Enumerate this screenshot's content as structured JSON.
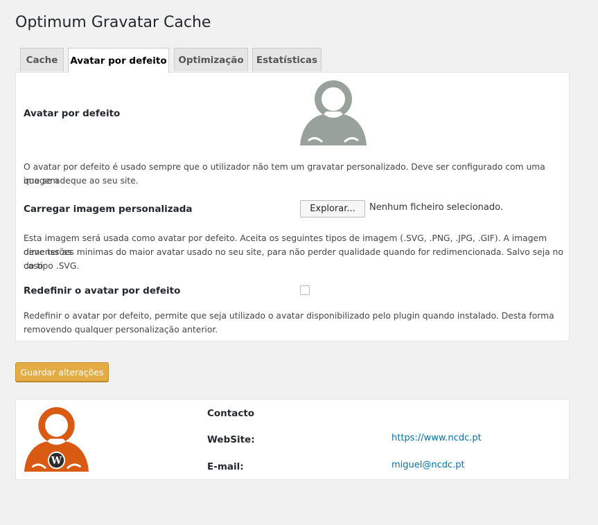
{
  "page_title": "Optimum Gravatar Cache",
  "tabs": [
    {
      "label": "Cache"
    },
    {
      "label": "Avatar por defeito"
    },
    {
      "label": "Optimização"
    },
    {
      "label": "Estatísticas"
    }
  ],
  "active_tab": "Avatar por defeito",
  "settings": {
    "default_avatar_label": "Avatar por defeito",
    "default_avatar_desc_1": "O avatar por defeito é usado sempre que o utilizador não tem um gravatar personalizado. Deve ser configurado com uma imagem",
    "default_avatar_desc_2": "que se adeque ao seu site.",
    "upload_label": "Carregar imagem personalizada",
    "upload_button": "Explorar...",
    "upload_status": "Nenhum ficheiro selecionado.",
    "upload_desc_1": "Esta imagem será usada como avatar por defeito. Aceita os seguintes tipos de imagem (.SVG, .PNG, .JPG, .GIF). A imagem deve ter as",
    "upload_desc_2": "dimenssões minimas do maior avatar usado no seu site, para não perder qualidade quando for redimencionada. Salvo seja no caso",
    "upload_desc_3": "do tipo .SVG.",
    "reset_label": "Redefinir o avatar por defeito",
    "reset_checked": false,
    "reset_desc_1": "Redefinir o avatar por defeito, permite que seja utilizado o avatar disponibilizado pelo plugin quando instalado. Desta forma",
    "reset_desc_2": "removendo qualquer personalização anterior."
  },
  "save_button": "Guardar alterações",
  "contact": {
    "title": "Contacto",
    "website_label": "WebSite:",
    "website_value": "https://www.ncdc.pt",
    "email_label": "E-mail:",
    "email_value": "miguel@ncdc.pt"
  },
  "colors": {
    "default_avatar": "#98a29a",
    "brand_avatar": "#d95a12",
    "save_button": "#e4ac45",
    "link": "#0073aa"
  }
}
